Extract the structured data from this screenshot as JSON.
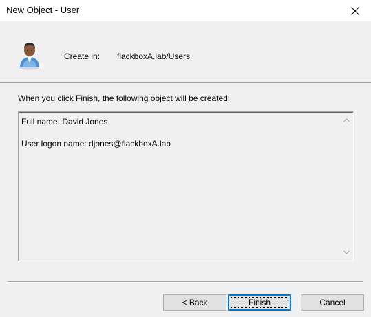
{
  "window": {
    "title": "New Object - User"
  },
  "header": {
    "create_label": "Create in:",
    "create_path": "flackboxA.lab/Users",
    "icon": "user-icon"
  },
  "main": {
    "info_text": "When you click Finish, the following object will be created:",
    "summary_lines": [
      "Full name: David Jones",
      "User logon name: djones@flackboxA.lab"
    ]
  },
  "buttons": {
    "back": "< Back",
    "finish": "Finish",
    "cancel": "Cancel"
  },
  "colors": {
    "accent": "#0078d7",
    "background": "#f0f0f0"
  }
}
